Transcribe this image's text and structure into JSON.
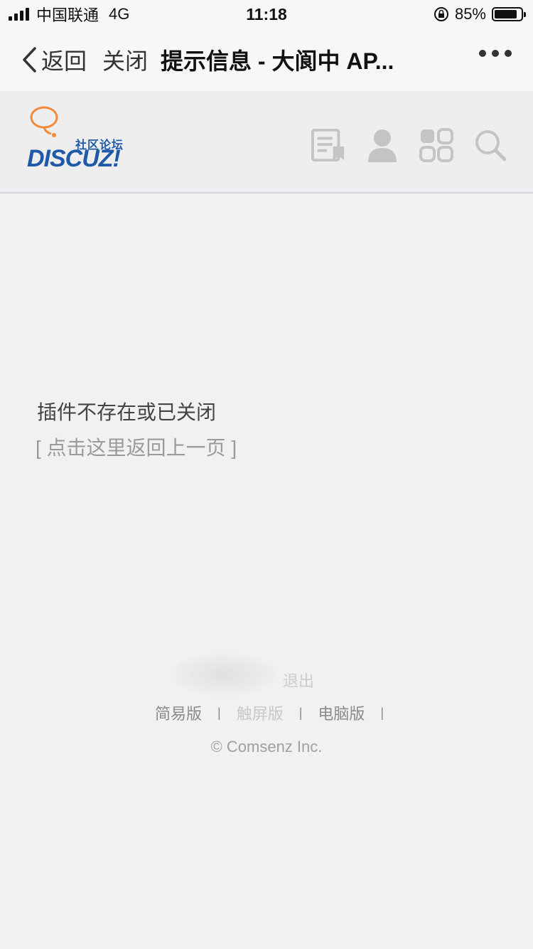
{
  "status_bar": {
    "carrier": "中国联通",
    "network": "4G",
    "time": "11:18",
    "battery_percent": "85%",
    "battery_level": 0.85
  },
  "nav_bar": {
    "back_label": "返回",
    "close_label": "关闭",
    "title": "提示信息 - 大阆中 AP..."
  },
  "site_header": {
    "logo_tagline": "社区论坛",
    "logo_text": "DISCUZ!",
    "icons": [
      "forum-list-icon",
      "user-icon",
      "apps-grid-icon",
      "search-icon"
    ]
  },
  "message": {
    "text": "插件不存在或已关闭",
    "back_link": "[ 点击这里返回上一页 ]"
  },
  "footer": {
    "logout": "退出",
    "links": [
      {
        "label": "简易版"
      },
      {
        "label": "触屏版"
      },
      {
        "label": "电脑版"
      }
    ],
    "separator": "|",
    "copyright": "© Comsenz Inc."
  },
  "colors": {
    "background": "#f1f1f1",
    "logo_blue": "#1f5aa8",
    "logo_orange": "#f08a3c",
    "icon_gray": "#c4c4c4"
  }
}
